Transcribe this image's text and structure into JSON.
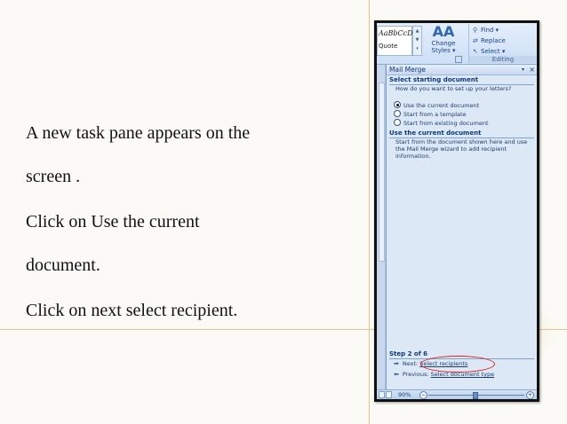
{
  "slide": {
    "para1_line1": "A new task pane appears on the",
    "para1_line2": "screen .",
    "para2_line1": "Click on Use the current",
    "para2_line2": "document.",
    "para3": "Click on next select recipient."
  },
  "ribbon": {
    "style_preview_top": "AaBbCcDc",
    "style_preview_bottom": "Quote",
    "change_styles_line1": "Change",
    "change_styles_line2": "Styles",
    "change_styles_icon": "AA",
    "find_label": "Find",
    "replace_label": "Replace",
    "select_label": "Select",
    "editing_group": "Editing"
  },
  "task_pane": {
    "title": "Mail Merge",
    "section1_heading": "Select starting document",
    "question": "How do you want to set up your letters?",
    "options": [
      {
        "label": "Use the current document",
        "selected": true
      },
      {
        "label": "Start from a template",
        "selected": false
      },
      {
        "label": "Start from existing document",
        "selected": false
      }
    ],
    "section2_heading": "Use the current document",
    "section2_description": "Start from the document shown here and use the Mail Merge wizard to add recipient information.",
    "step_label": "Step 2 of 6",
    "next_prefix": "Next:",
    "next_link": "Select recipients",
    "previous_prefix": "Previous:",
    "previous_link": "Select document type"
  },
  "status_bar": {
    "zoom": "90%"
  },
  "colors": {
    "highlight_ellipse": "#e02020",
    "ribbon_text": "#15428b"
  }
}
